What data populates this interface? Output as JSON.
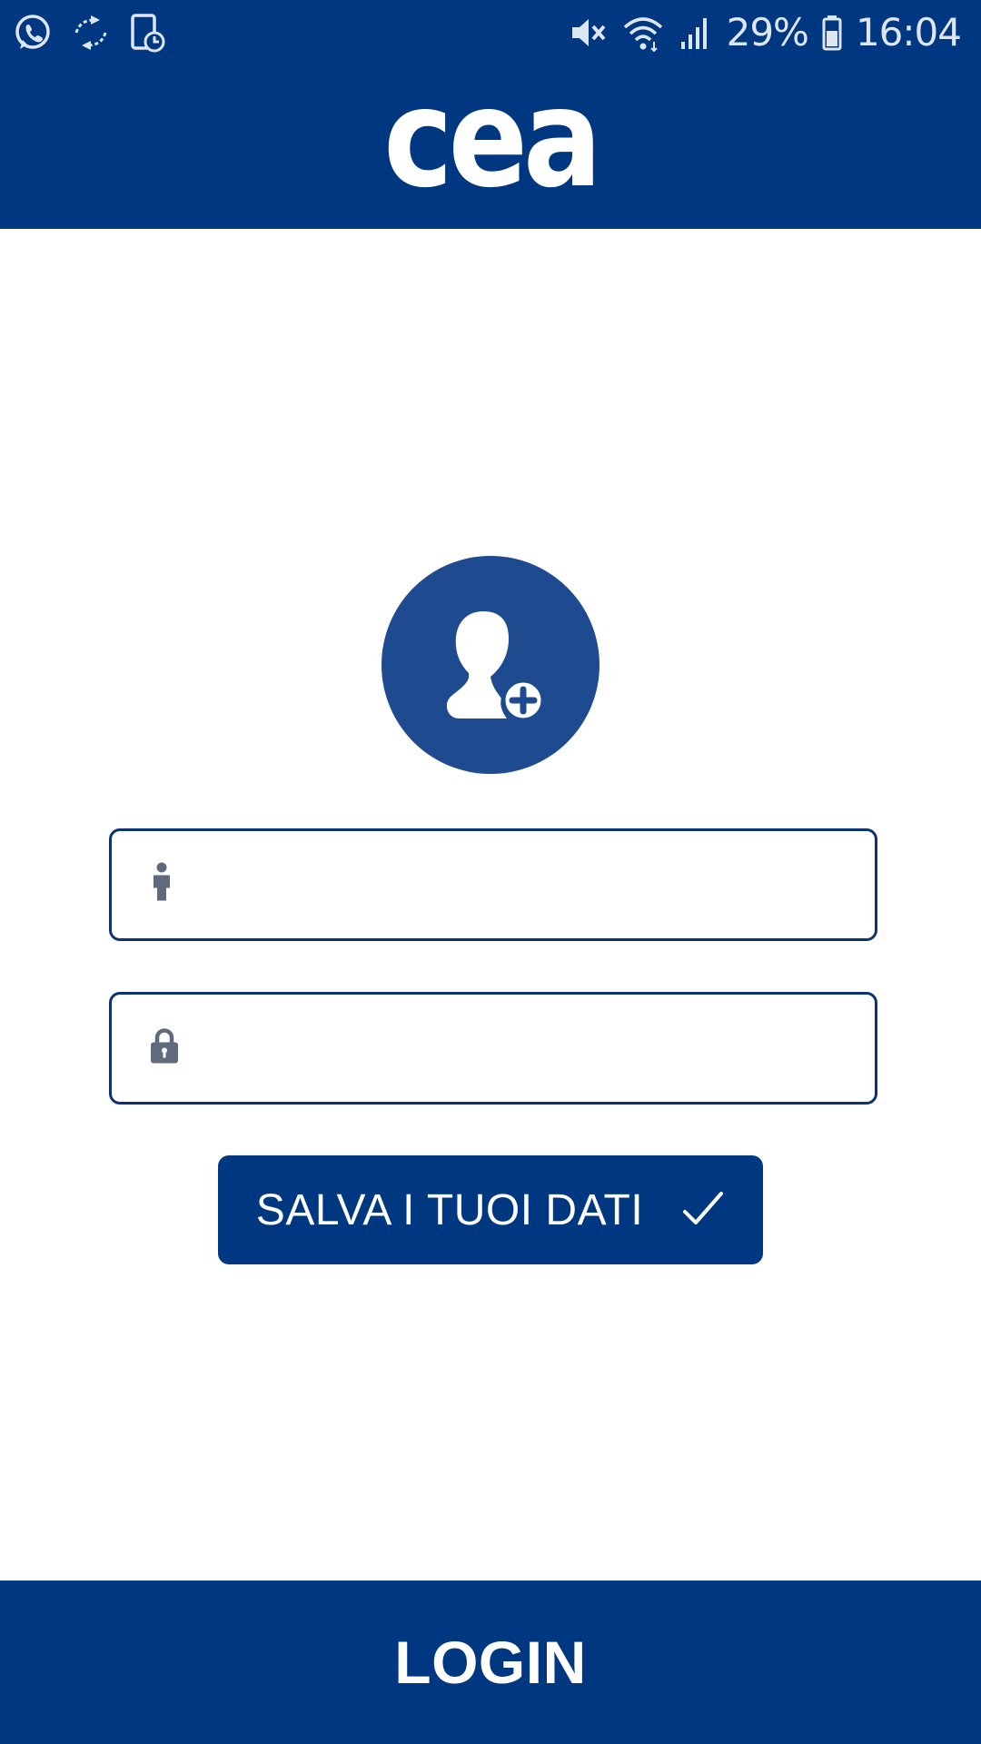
{
  "status_bar": {
    "battery_percent": "29%",
    "time": "16:04",
    "icons": [
      "whatsapp-icon",
      "sync-icon",
      "screen-timer-icon",
      "mute-icon",
      "wifi-icon",
      "signal-icon",
      "battery-icon"
    ]
  },
  "header": {
    "logo_text": "cea"
  },
  "avatar": {
    "icon": "add-user-icon"
  },
  "form": {
    "username": {
      "value": "",
      "placeholder": "",
      "icon": "user-icon"
    },
    "password": {
      "value": "",
      "placeholder": "",
      "icon": "lock-icon"
    }
  },
  "save_button": {
    "label": "SALVA I TUOI DATI",
    "icon": "checkmark-icon"
  },
  "login_button": {
    "label": "LOGIN"
  },
  "colors": {
    "brand_blue": "#003781",
    "avatar_blue": "#1e4b8f",
    "field_border": "#0b3272",
    "field_icon": "#5f6b7d"
  }
}
